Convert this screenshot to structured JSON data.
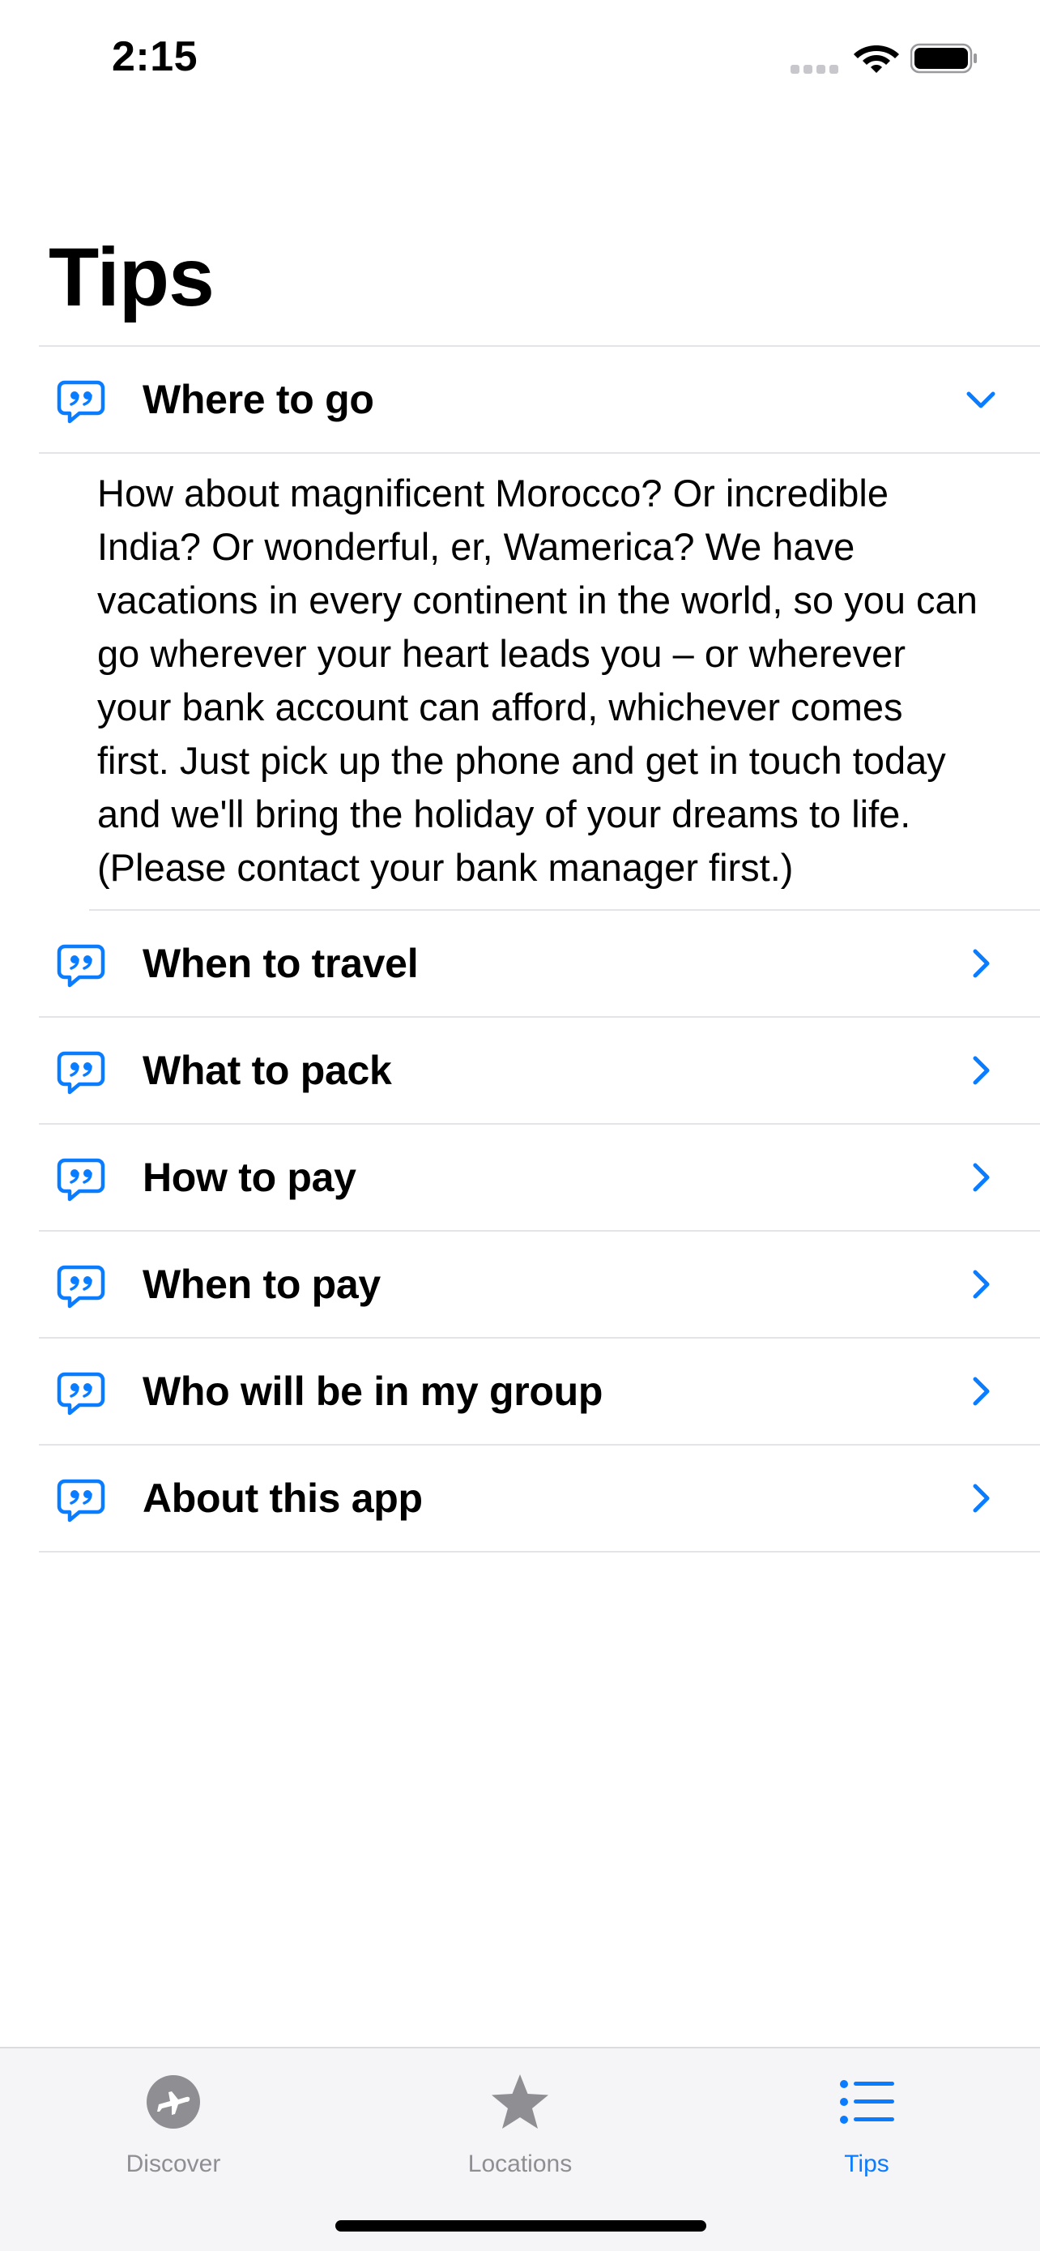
{
  "status": {
    "time": "2:15"
  },
  "page": {
    "title": "Tips"
  },
  "colors": {
    "accent": "#0a7cff",
    "inactive": "#8e8e93",
    "divider": "#e3e3e8"
  },
  "tips": [
    {
      "title": "Where to go",
      "expanded": true,
      "body": "How about magnificent Morocco? Or incredible India? Or wonderful, er, Wamerica? We have vacations in every continent in the world, so you can go wherever your heart leads you – or wherever your bank account can afford, whichever comes first. Just pick up the phone and get in touch today and we'll bring the holiday of your dreams to life. (Please contact your bank manager first.)"
    },
    {
      "title": "When to travel",
      "expanded": false
    },
    {
      "title": "What to pack",
      "expanded": false
    },
    {
      "title": "How to pay",
      "expanded": false
    },
    {
      "title": "When to pay",
      "expanded": false
    },
    {
      "title": "Who will be in my group",
      "expanded": false
    },
    {
      "title": "About this app",
      "expanded": false
    }
  ],
  "icons": {
    "row": "quote-bubble-icon",
    "expanded": "chevron-down-icon",
    "collapsed": "chevron-right-icon"
  },
  "tabbar": {
    "tabs": [
      {
        "label": "Discover",
        "icon": "airplane-circle-icon",
        "active": false
      },
      {
        "label": "Locations",
        "icon": "star-icon",
        "active": false
      },
      {
        "label": "Tips",
        "icon": "list-icon",
        "active": true
      }
    ]
  }
}
